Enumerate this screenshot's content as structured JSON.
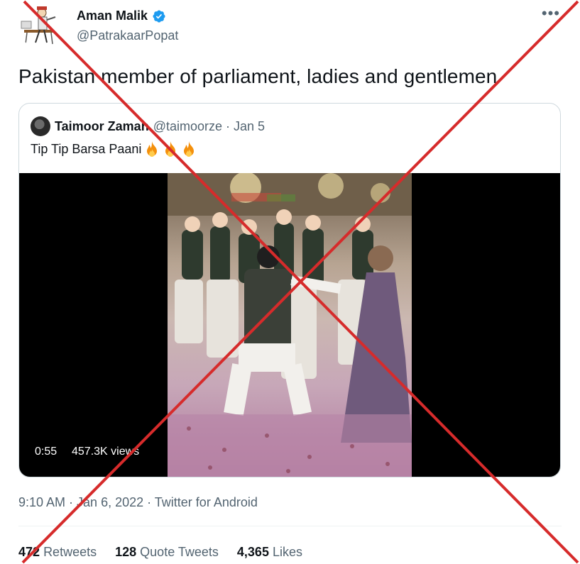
{
  "author": {
    "name": "Aman Malik",
    "handle": "@PatrakaarPopat"
  },
  "more_glyph": "•••",
  "tweet_text": "Pakistan member of parliament, ladies and gentlemen",
  "quoted": {
    "name": "Taimoor Zaman",
    "meta": "@taimoorze · Jan 5",
    "text": "Tip Tip Barsa Paani",
    "emojis": [
      "fire-emoji",
      "fire-emoji",
      "fire-emoji"
    ],
    "video": {
      "duration": "0:55",
      "views": "457.3K views"
    }
  },
  "meta": {
    "time": "9:10 AM",
    "date": "Jan 6, 2022",
    "source": "Twitter for Android",
    "sep": " · "
  },
  "stats": [
    {
      "count": "472",
      "label": "Retweets"
    },
    {
      "count": "128",
      "label": "Quote Tweets"
    },
    {
      "count": "4,365",
      "label": "Likes"
    }
  ],
  "colors": {
    "verified": "#1d9bf0",
    "cross": "#d62b2b",
    "muted": "#536471",
    "text": "#0f1419"
  }
}
